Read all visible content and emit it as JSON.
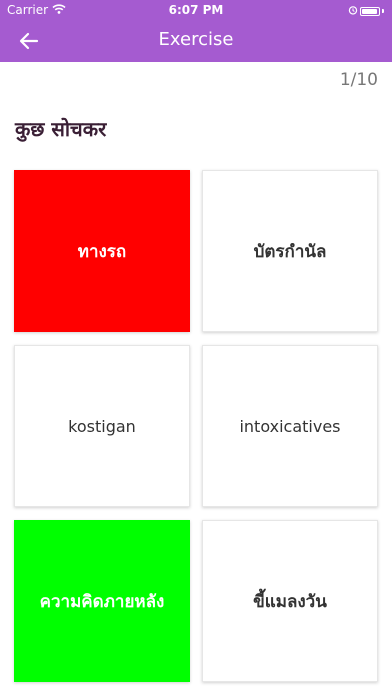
{
  "status_bar": {
    "carrier": "Carrier",
    "time": "6:07 PM"
  },
  "nav": {
    "title": "Exercise",
    "back_icon": "arrow-left-icon"
  },
  "progress": "1/10",
  "prompt": "कुछ सोचकर",
  "options": [
    {
      "label": "ทางรถ",
      "state": "wrong",
      "color": "#ff0000"
    },
    {
      "label": "บัตรกำนัล",
      "state": "neutral",
      "color": "#ffffff"
    },
    {
      "label": "kostigan",
      "state": "neutral",
      "color": "#ffffff"
    },
    {
      "label": "intoxicatives",
      "state": "neutral",
      "color": "#ffffff"
    },
    {
      "label": "ความคิดภายหลัง",
      "state": "correct",
      "color": "#00ff00"
    },
    {
      "label": "ขี้แมลงวัน",
      "state": "neutral",
      "color": "#ffffff"
    }
  ],
  "colors": {
    "header": "#a55bd0",
    "wrong": "#ff0000",
    "correct": "#00ff00"
  }
}
